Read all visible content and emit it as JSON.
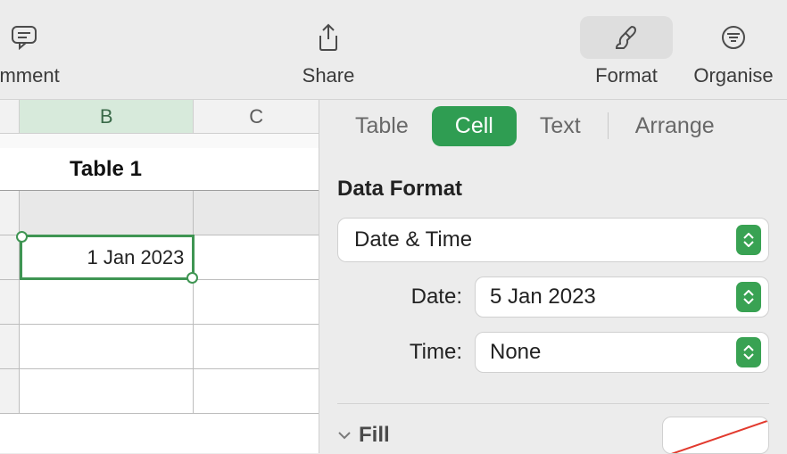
{
  "toolbar": {
    "comment": "omment",
    "share": "Share",
    "format": "Format",
    "organise": "Organise"
  },
  "sheet": {
    "columns": [
      "B",
      "C"
    ],
    "table_title": "Table 1",
    "cell_value": "1 Jan 2023"
  },
  "inspector": {
    "tabs": {
      "table": "Table",
      "cell": "Cell",
      "text": "Text",
      "arrange": "Arrange"
    },
    "section_title": "Data Format",
    "format_select": "Date & Time",
    "date_label": "Date:",
    "date_value": "5 Jan 2023",
    "time_label": "Time:",
    "time_value": "None",
    "fill_label": "Fill"
  }
}
